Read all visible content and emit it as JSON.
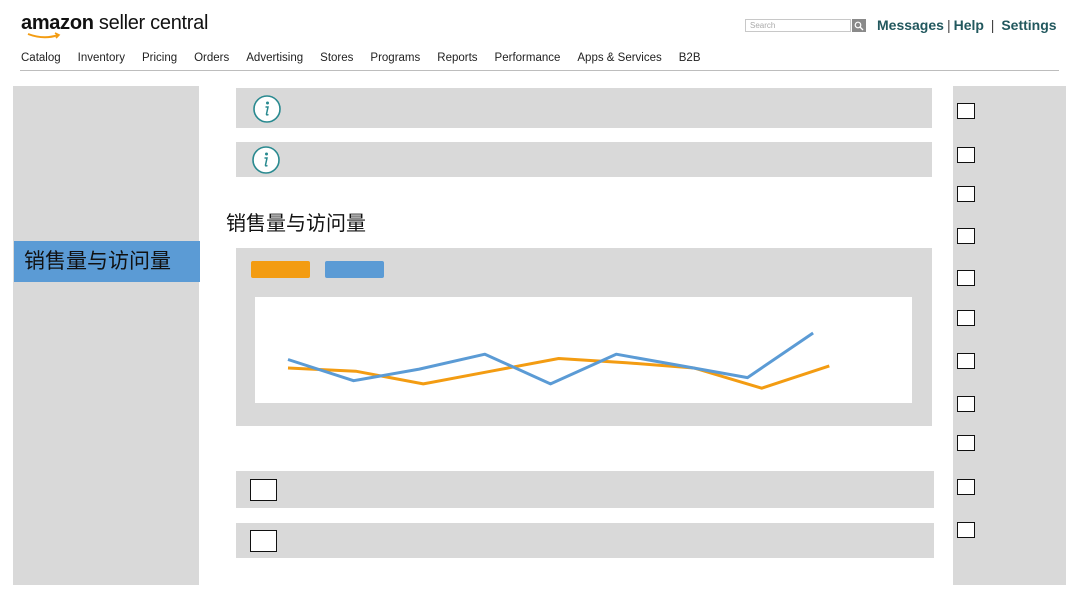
{
  "header": {
    "logo_bold": "amazon",
    "logo_rest": " seller central",
    "search_placeholder": "Search",
    "links": [
      "Messages",
      "Help",
      "Settings"
    ]
  },
  "nav": [
    "Catalog",
    "Inventory",
    "Pricing",
    "Orders",
    "Advertising",
    "Stores",
    "Programs",
    "Reports",
    "Performance",
    "Apps & Services",
    "B2B"
  ],
  "sidebar": {
    "active_item": "销售量与访问量"
  },
  "main": {
    "section_title": "销售量与访问量"
  },
  "colors": {
    "orange": "#f39c12",
    "blue": "#5b9bd5",
    "panel": "#d9d9d9",
    "link": "#22585e"
  },
  "icons": {
    "info": "info-icon",
    "search": "search-icon"
  },
  "chart_data": {
    "type": "line",
    "x": [
      1,
      2,
      3,
      4,
      5,
      6,
      7,
      8,
      9,
      10,
      11
    ],
    "ylim": [
      0,
      10
    ],
    "series": [
      {
        "color": "#f39c12",
        "values": [
          3.3,
          3.0,
          1.8,
          3.0,
          4.2,
          3.8,
          3.3,
          1.4,
          3.5,
          null,
          null
        ]
      },
      {
        "color": "#5b9bd5",
        "values": [
          4.1,
          2.1,
          3.2,
          4.6,
          1.8,
          4.6,
          3.5,
          2.4,
          6.6,
          null,
          null
        ]
      }
    ]
  }
}
